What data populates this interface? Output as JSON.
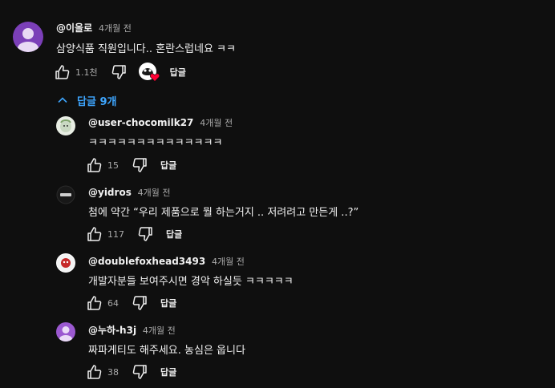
{
  "comment": {
    "author": "@이올로",
    "time": "4개월 전",
    "text": "삼양식품 직원입니다.. 혼란스럽네요 ㅋㅋ",
    "likes": "1.1천",
    "reply_label": "답글"
  },
  "replies_toggle": {
    "label": "답글 9개"
  },
  "replies": [
    {
      "author": "@user-chocomilk27",
      "time": "4개월 전",
      "text": "ㅋㅋㅋㅋㅋㅋㅋㅋㅋㅋㅋㅋㅋㅋ",
      "likes": "15",
      "reply_label": "답글"
    },
    {
      "author": "@yidros",
      "time": "4개월 전",
      "text": "첨에 약간 “우리 제품으로 뭘 하는거지 .. 저려려고 만든게 ..?”",
      "likes": "117",
      "reply_label": "답글"
    },
    {
      "author": "@doublefoxhead3493",
      "time": "4개월 전",
      "text": "개발자분들 보여주시면 경악 하실듯 ㅋㅋㅋㅋㅋ",
      "likes": "64",
      "reply_label": "답글"
    },
    {
      "author": "@누하-h3j",
      "time": "4개월 전",
      "text": "짜파게티도 해주세요. 농심은 웁니다",
      "likes": "38",
      "reply_label": "답글"
    }
  ],
  "colors": {
    "background": "#0f0f0f",
    "link": "#3ea6ff",
    "heart": "#ff0033",
    "avatar_purple": "#7b3fb8",
    "avatar_purple_light": "#9b59d0"
  }
}
